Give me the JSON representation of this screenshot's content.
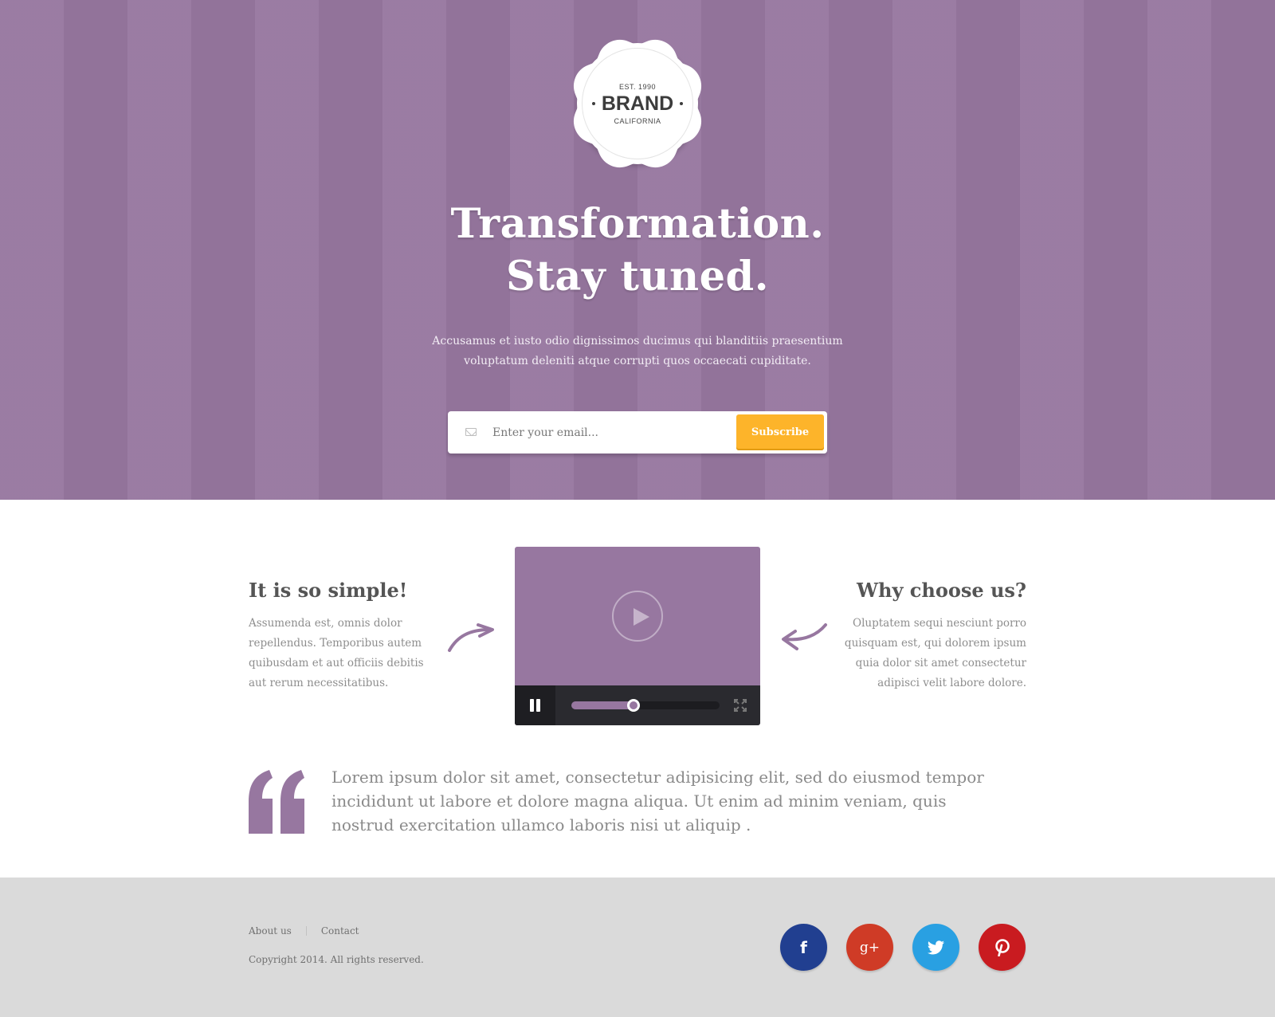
{
  "badge": {
    "est": "EST. 1990",
    "brand": "BRAND",
    "place": "CALIFORNIA"
  },
  "hero": {
    "headline_line1": "Transformation.",
    "headline_line2": "Stay tuned.",
    "text": "Accusamus et iusto odio dignissimos ducimus qui blanditiis praesentium voluptatum deleniti atque corrupti quos occaecati cupiditate.",
    "email_placeholder": "Enter your email...",
    "subscribe_label": "Subscribe"
  },
  "features": {
    "left": {
      "title": "It is so simple!",
      "text": "Assumenda est, omnis dolor repellendus. Temporibus autem quibusdam et aut officiis debitis aut rerum necessitatibus."
    },
    "right": {
      "title": "Why choose us?",
      "text": "Oluptatem sequi nesciunt porro quisquam est, qui dolorem ipsum quia dolor sit amet consectetur adipisci velit labore dolore."
    }
  },
  "video": {
    "progress": 0.42
  },
  "quote": {
    "text": "Lorem ipsum dolor sit amet, consectetur adipisicing elit, sed do eiusmod tempor incididunt ut labore et dolore magna aliqua. Ut enim ad minim veniam, quis nostrud exercitation ullamco laboris nisi ut aliquip ."
  },
  "footer": {
    "links": [
      "About us",
      "Contact"
    ],
    "copyright": "Copyright 2014. All rights reserved.",
    "social": [
      {
        "icon": "facebook-icon",
        "glyph": "f",
        "color": "#213f90"
      },
      {
        "icon": "google-plus-icon",
        "glyph": "g+",
        "color": "#cf3b26"
      },
      {
        "icon": "twitter-icon",
        "glyph": "",
        "color": "#29a0e2"
      },
      {
        "icon": "pinterest-icon",
        "glyph": "p",
        "color": "#c91b20"
      }
    ]
  },
  "colors": {
    "brand_purple": "#9777a0",
    "accent_orange": "#fdb42a",
    "footer_bg": "#dadada"
  }
}
